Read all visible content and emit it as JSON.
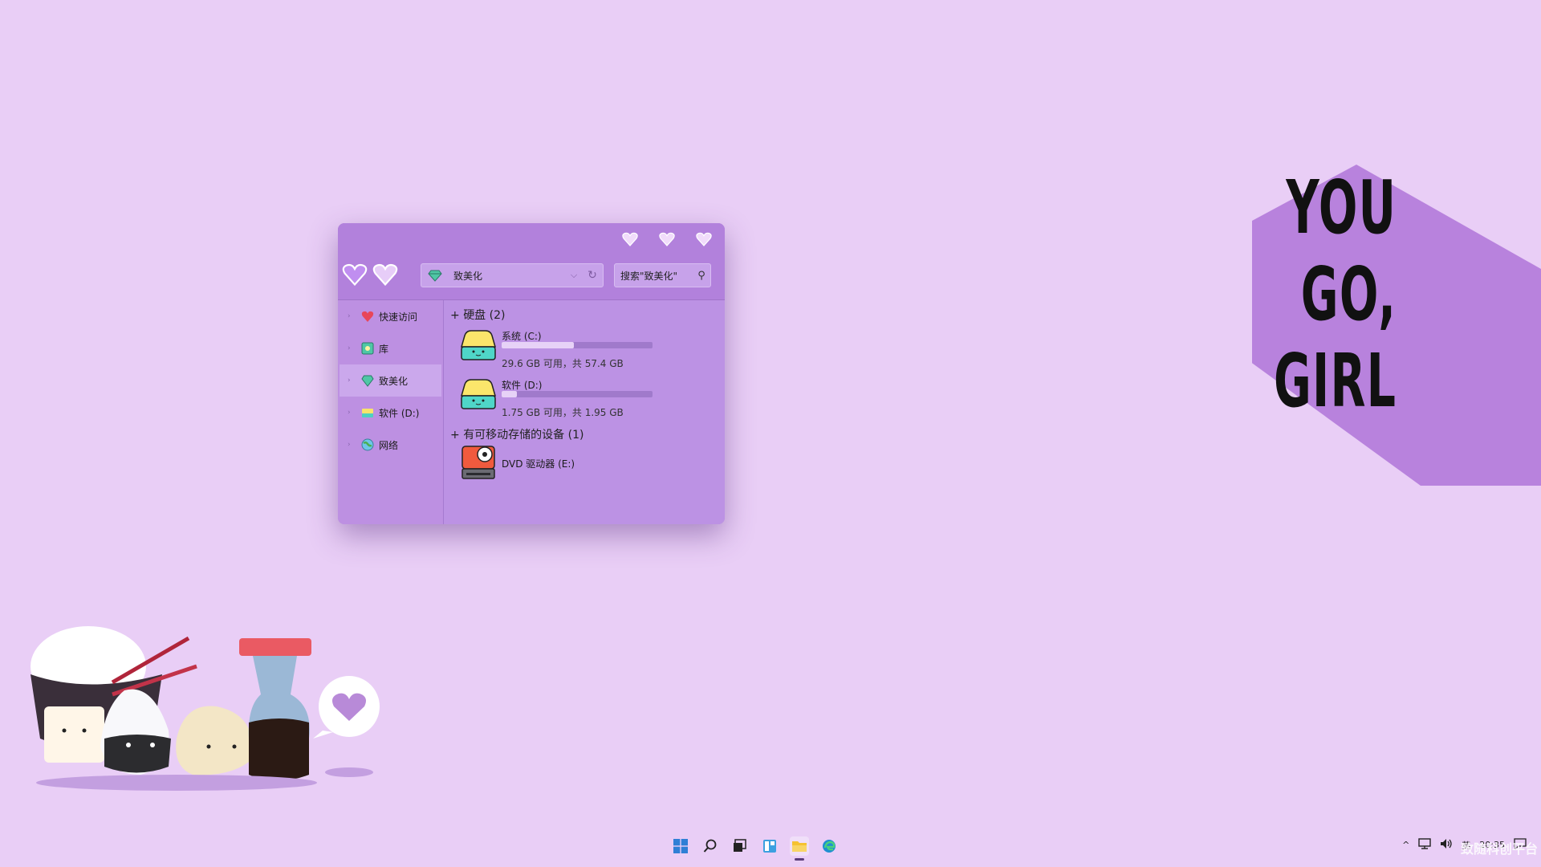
{
  "wallpaper": {
    "poster_lines": [
      "YOU",
      "GO,",
      "GIRL"
    ]
  },
  "explorer": {
    "address": {
      "text": "致美化",
      "icon": "diamond-icon"
    },
    "search": {
      "placeholder": "搜索\"致美化\""
    },
    "caption_icons": [
      "minimize-heart-icon",
      "maximize-heart-icon",
      "close-heart-icon"
    ],
    "sidebar": {
      "items": [
        {
          "label": "快速访问",
          "icon": "heart-star-icon"
        },
        {
          "label": "库",
          "icon": "library-icon"
        },
        {
          "label": "致美化",
          "icon": "diamond-icon"
        },
        {
          "label": "软件 (D:)",
          "icon": "drive-icon"
        },
        {
          "label": "网络",
          "icon": "globe-icon"
        }
      ],
      "active_index": 2
    },
    "groups": {
      "hard_disks": {
        "label": "硬盘 (2)",
        "toggle": "+"
      },
      "removable": {
        "label": "有可移动存储的设备 (1)",
        "toggle": "+"
      }
    },
    "drives": [
      {
        "name": "系统 (C:)",
        "info": "29.6 GB 可用，共 57.4 GB",
        "used_fraction": 0.48
      },
      {
        "name": "软件 (D:)",
        "info": "1.75 GB 可用，共 1.95 GB",
        "used_fraction": 0.1
      }
    ],
    "dvd": {
      "name": "DVD 驱动器 (E:)"
    }
  },
  "taskbar": {
    "icons": [
      "windows-start-icon",
      "search-icon",
      "task-view-icon",
      "widgets-icon",
      "file-explorer-icon",
      "edge-browser-icon"
    ],
    "active_index": 4,
    "tray": {
      "chevron": "^",
      "lang": "英",
      "time": "20:35"
    },
    "watermark": "致随科创平台"
  },
  "colors": {
    "desktop_bg": "#e9cef6",
    "window_bg": "#b98ae0",
    "accent": "#a36bd6"
  }
}
